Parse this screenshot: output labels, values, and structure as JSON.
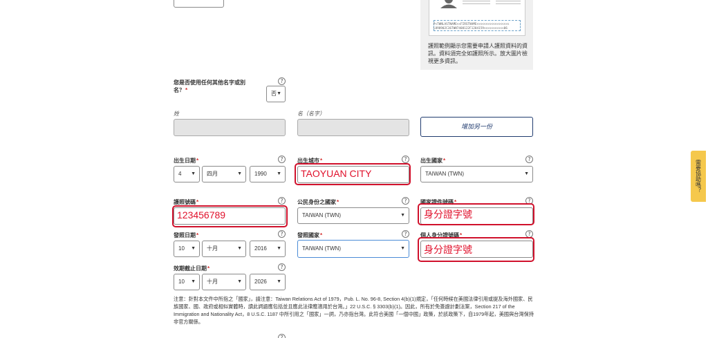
{
  "passport_sample": {
    "mrz_line1": "P<TWNLASTNAME<<FIRSTNAME<<<<<<<<<<<<<<<<<<",
    "mrz_line2": "L898902C36TWN7408122F1204159<<<<<<<<<<<06",
    "note": "護照範例顯示您需要申請人護照資料的資訊。資料須完全如護照所示。放大圖片檢視更多資訊。"
  },
  "other_names": {
    "question": "您是否使用任何其他名字或別名？",
    "required_mark": "*",
    "answer": "否",
    "surname_label": "姓",
    "given_name_label": "名（名字）",
    "add_button": "增加另一份"
  },
  "birth": {
    "date_label": "出生日期",
    "day": "4",
    "month": "四月",
    "year": "1990",
    "city_label": "出生城市",
    "city_annotation": "TAOYUAN CITY",
    "country_label": "出生國家",
    "country": "TAIWAN (TWN)"
  },
  "passport": {
    "number_label": "護照號碼",
    "number_annotation": "123456789",
    "citizenship_label": "公民身份之國家",
    "citizenship": "TAIWAN (TWN)",
    "national_id_label": "國家證件號碼",
    "national_id_annotation": "身分證字號",
    "issue_date_label": "發照日期",
    "issue_day": "10",
    "issue_month": "十月",
    "issue_year": "2016",
    "issue_country_label": "發照國家",
    "issue_country": "TAIWAN (TWN)",
    "personal_id_label": "個人身分證號碼",
    "personal_id_annotation": "身分證字號",
    "expiry_label": "效期截止日期",
    "expiry_day": "10",
    "expiry_month": "十月",
    "expiry_year": "2026"
  },
  "notice": "注意：針對本文件中所指之「國家」，請注意：Taiwan Relations Act of 1979，Pub. L. No. 96-8, Section 4(b)(1)規定，「任何時候在美國法律引用或提及海外國家、民族國家、國、政府或相似實體時，讀此詞語應包括並且應此法律應適用於台灣。」22 U.S.C. § 3303(b)(1)。因此，所有於免簽證計劃法案，Section 217 of the Immigration and Nationality Act，8 U.S.C. 1187 中所引用之「國家」一詞，乃亦指台灣。此符合美國「一個中國」政策，於該政策下，自1979年起，美國與台灣保持非官方關係。",
  "side_tab": "需要協助嗎？",
  "help_glyph": "?",
  "select_arrow": "▼"
}
